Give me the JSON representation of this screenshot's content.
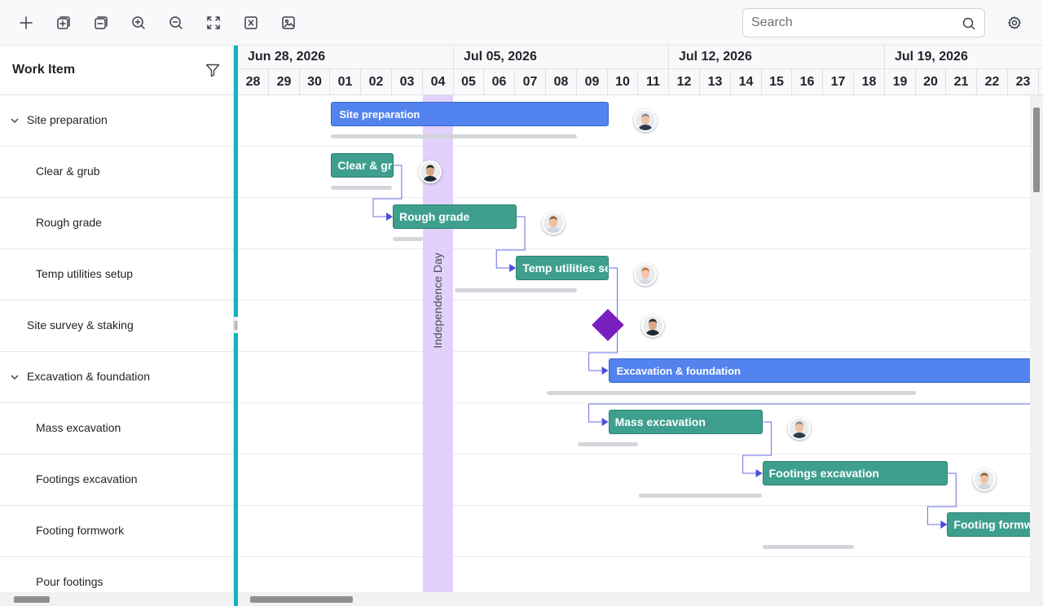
{
  "toolbar": {
    "buttons": [
      {
        "name": "add-task-button",
        "icon": "plus-icon"
      },
      {
        "name": "expand-all-button",
        "icon": "expand-all-icon"
      },
      {
        "name": "collapse-all-button",
        "icon": "collapse-all-icon"
      },
      {
        "name": "zoom-in-button",
        "icon": "zoom-in-icon"
      },
      {
        "name": "zoom-out-button",
        "icon": "zoom-out-icon"
      },
      {
        "name": "fit-to-screen-button",
        "icon": "fullscreen-icon"
      },
      {
        "name": "export-excel-button",
        "icon": "excel-icon"
      },
      {
        "name": "export-image-button",
        "icon": "image-export-icon"
      }
    ],
    "search_placeholder": "Search",
    "search_value": ""
  },
  "grid": {
    "header_title": "Work Item",
    "rows": [
      {
        "label": "Site preparation",
        "level": 0,
        "expandable": true
      },
      {
        "label": "Clear & grub",
        "level": 1,
        "expandable": false
      },
      {
        "label": "Rough grade",
        "level": 1,
        "expandable": false
      },
      {
        "label": "Temp utilities setup",
        "level": 1,
        "expandable": false
      },
      {
        "label": "Site survey & staking",
        "level": 0,
        "expandable": false
      },
      {
        "label": "Excavation & foundation",
        "level": 0,
        "expandable": true
      },
      {
        "label": "Mass excavation",
        "level": 1,
        "expandable": false
      },
      {
        "label": "Footings excavation",
        "level": 1,
        "expandable": false
      },
      {
        "label": "Footing formwork",
        "level": 1,
        "expandable": false
      },
      {
        "label": "Pour footings",
        "level": 1,
        "expandable": false
      }
    ]
  },
  "timeline": {
    "weeks": [
      "Jun 28, 2026",
      "Jul 05, 2026",
      "Jul 12, 2026",
      "Jul 19, 2026"
    ],
    "days": [
      "28",
      "29",
      "30",
      "01",
      "02",
      "03",
      "04",
      "05",
      "06",
      "07",
      "08",
      "09",
      "10",
      "11",
      "12",
      "13",
      "14",
      "15",
      "16",
      "17",
      "18",
      "19",
      "20",
      "21",
      "22",
      "23"
    ],
    "holiday": {
      "label": "Independence Day",
      "day": "04"
    }
  },
  "tasks": [
    {
      "name": "Site preparation",
      "type": "summary",
      "row": 0,
      "start": 3,
      "end": 12.05,
      "baseline_start": 3,
      "baseline_end": 11
    },
    {
      "name": "Clear & grub",
      "type": "task",
      "row": 1,
      "start": 3,
      "end": 5.05,
      "baseline_start": 3,
      "baseline_end": 5
    },
    {
      "name": "Rough grade",
      "type": "task",
      "row": 2,
      "start": 5,
      "end": 9.05,
      "baseline_start": 5,
      "baseline_end": 6
    },
    {
      "name": "Temp utilities setup",
      "type": "task",
      "row": 3,
      "start": 9,
      "end": 12.05,
      "baseline_start": 7,
      "baseline_end": 11
    },
    {
      "name": "Site survey & staking",
      "type": "milestone",
      "row": 4,
      "at": 12
    },
    {
      "name": "Excavation & foundation",
      "type": "summary",
      "row": 5,
      "start": 12,
      "end": 26.2,
      "baseline_start": 10,
      "baseline_end": 22
    },
    {
      "name": "Mass excavation",
      "type": "task",
      "row": 6,
      "start": 12,
      "end": 17.05,
      "baseline_start": 11,
      "baseline_end": 13
    },
    {
      "name": "Footings excavation",
      "type": "task",
      "row": 7,
      "start": 17,
      "end": 23.05,
      "baseline_start": 13,
      "baseline_end": 17
    },
    {
      "name": "Footing formwork",
      "type": "task",
      "row": 8,
      "start": 23,
      "end": 26.2,
      "baseline_start": 17,
      "baseline_end": 20
    }
  ],
  "resources": [
    {
      "row": 0,
      "avatar": "man-gray-hair"
    },
    {
      "row": 1,
      "avatar": "man-dark-hair"
    },
    {
      "row": 2,
      "avatar": "man-brown-hair"
    },
    {
      "row": 3,
      "avatar": "woman-red-hair"
    },
    {
      "row": 4,
      "avatar": "man-dark-hair"
    },
    {
      "row": 6,
      "avatar": "man-gray-hair"
    },
    {
      "row": 7,
      "avatar": "man-brown-hair"
    }
  ],
  "dependencies": [
    {
      "from": 1,
      "to": 2
    },
    {
      "from": 2,
      "to": 3
    },
    {
      "from": 3,
      "to": 5
    },
    {
      "from": 5,
      "to": 6
    },
    {
      "from": 6,
      "to": 7
    },
    {
      "from": 7,
      "to": 8
    }
  ],
  "colors": {
    "summary_bar": "#5383ee",
    "task_bar": "#3e9f8e",
    "milestone": "#7a1fbf",
    "holiday": "#e2d2fb",
    "splitter": "#0fb5c4",
    "dependency": "#6b6ee0"
  }
}
